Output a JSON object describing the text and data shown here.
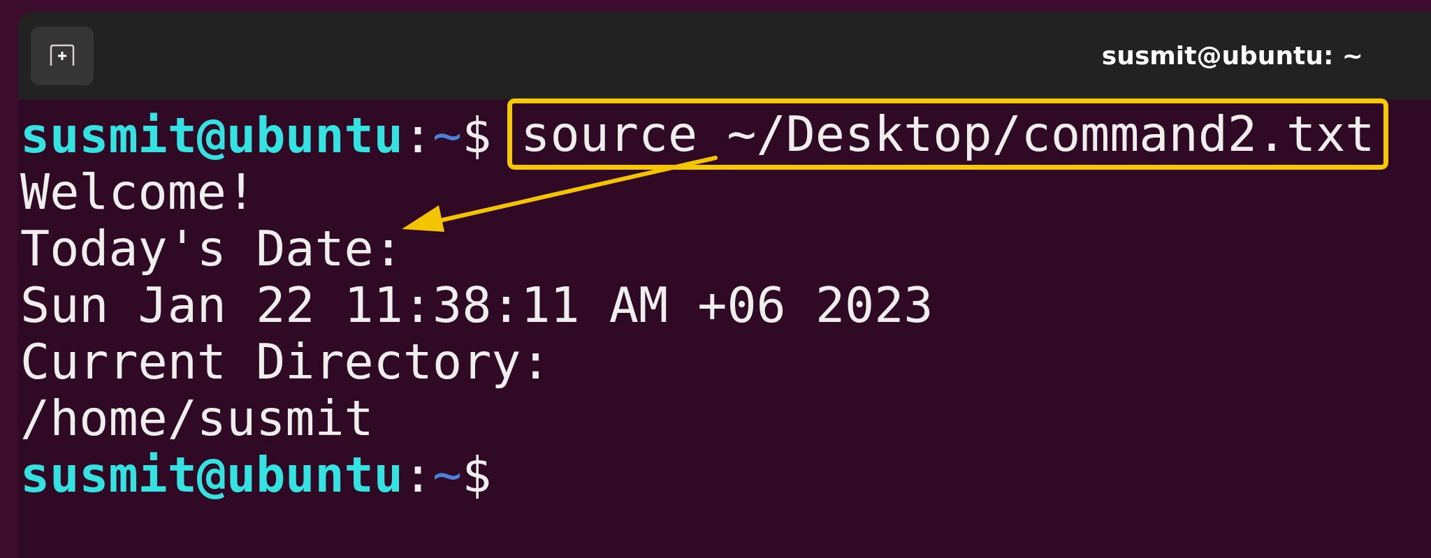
{
  "window": {
    "title": "susmit@ubuntu: ~"
  },
  "lines": [
    {
      "kind": "prompt",
      "user_host": "susmit@ubuntu",
      "separator": ":",
      "path": "~",
      "symbol": "$",
      "command": "source ~/Desktop/command2.txt",
      "highlighted": true
    },
    {
      "kind": "output",
      "text": "Welcome!"
    },
    {
      "kind": "output",
      "text": "Today's Date:"
    },
    {
      "kind": "output",
      "text": "Sun Jan 22 11:38:11 AM +06 2023"
    },
    {
      "kind": "output",
      "text": "Current Directory:"
    },
    {
      "kind": "output",
      "text": "/home/susmit"
    },
    {
      "kind": "prompt",
      "user_host": "susmit@ubuntu",
      "separator": ":",
      "path": "~",
      "symbol": "$"
    }
  ]
}
